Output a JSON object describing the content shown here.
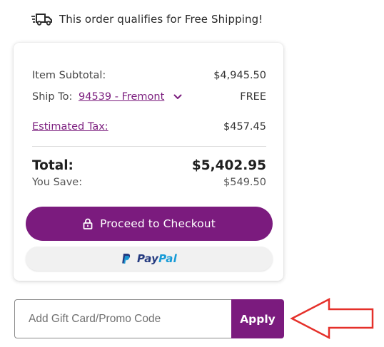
{
  "shipping_banner": {
    "icon": "fast-truck-icon",
    "text": "This order qualifies for Free Shipping!"
  },
  "summary": {
    "item_subtotal_label": "Item Subtotal:",
    "item_subtotal_value": "$4,945.50",
    "ship_to_label": "Ship To:",
    "ship_to_location": "94539 - Fremont",
    "ship_value": "FREE",
    "tax_label": "Estimated Tax:",
    "tax_value": "$457.45",
    "total_label": "Total:",
    "total_value": "$5,402.95",
    "save_label": "You Save:",
    "save_value": "$549.50"
  },
  "actions": {
    "checkout_label": "Proceed to Checkout",
    "checkout_icon": "lock-icon",
    "paypal_pay": "Pay",
    "paypal_pal": "Pal",
    "paypal_icon": "paypal-logo-icon"
  },
  "promo": {
    "placeholder": "Add Gift Card/Promo Code",
    "apply_label": "Apply"
  },
  "colors": {
    "brand_purple": "#7b1b7e",
    "annotation_red": "#e5302a",
    "paypal_dark_blue": "#253b80",
    "paypal_light_blue": "#179bd7"
  }
}
